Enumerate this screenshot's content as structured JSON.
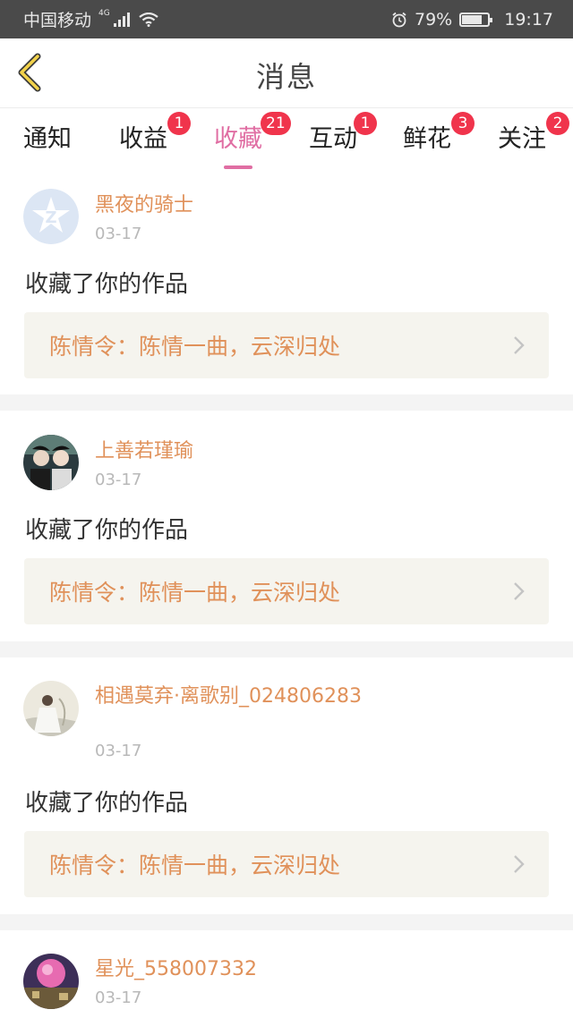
{
  "status_bar": {
    "carrier": "中国移动",
    "network": "4G",
    "battery_percent": "79%",
    "battery_level": 0.79,
    "time": "19:17"
  },
  "header": {
    "title": "消息",
    "back_icon": "chevron-left-icon"
  },
  "tabs": [
    {
      "label": "通知",
      "badge": ""
    },
    {
      "label": "收益",
      "badge": "1"
    },
    {
      "label": "收藏",
      "badge": "21",
      "active": true
    },
    {
      "label": "互动",
      "badge": "1"
    },
    {
      "label": "鲜花",
      "badge": "3"
    },
    {
      "label": "关注",
      "badge": "2"
    }
  ],
  "colors": {
    "accent": "#e06ea3",
    "badge": "#f0344c",
    "username": "#e0915a"
  },
  "messages": [
    {
      "username": "黑夜的骑士",
      "date": "03-17",
      "action": "收藏了你的作品",
      "work_title": "陈情令：陈情一曲，云深归处",
      "avatar": "default-avatar-icon"
    },
    {
      "username": "上善若瑾瑜",
      "date": "03-17",
      "action": "收藏了你的作品",
      "work_title": "陈情令：陈情一曲，云深归处",
      "avatar": "photo-avatar"
    },
    {
      "username": "相遇莫弃·离歌别_024806283",
      "date": "03-17",
      "action": "收藏了你的作品",
      "work_title": "陈情令：陈情一曲，云深归处",
      "avatar": "photo-avatar"
    },
    {
      "username": "星光_558007332",
      "date": "03-17",
      "avatar": "photo-avatar"
    }
  ]
}
